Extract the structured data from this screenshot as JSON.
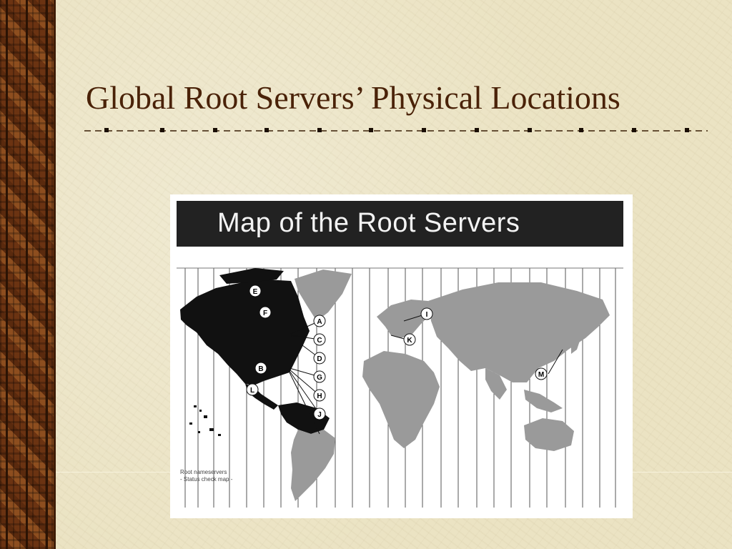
{
  "slide": {
    "title": "Global Root Servers’ Physical Locations"
  },
  "map": {
    "header": "Map of the Root Servers",
    "legend": {
      "line1": "Root nameservers",
      "line2": "- Status check map -"
    },
    "servers": [
      {
        "letter": "E"
      },
      {
        "letter": "F"
      },
      {
        "letter": "A"
      },
      {
        "letter": "C"
      },
      {
        "letter": "D"
      },
      {
        "letter": "G"
      },
      {
        "letter": "H"
      },
      {
        "letter": "J"
      },
      {
        "letter": "B"
      },
      {
        "letter": "L"
      },
      {
        "letter": "I"
      },
      {
        "letter": "K"
      },
      {
        "letter": "M"
      }
    ]
  },
  "colors": {
    "background": "#ebe3c3",
    "title": "#4a2208",
    "sidebar": "#6b3312",
    "map_header": "#222222",
    "north_america": "#111111",
    "rest_of_world": "#9a9a9a"
  }
}
